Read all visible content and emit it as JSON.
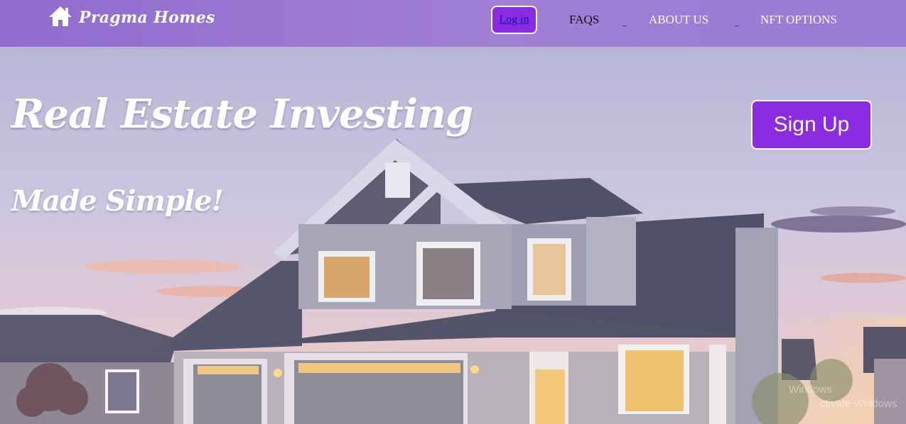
{
  "nav": {
    "brand": "Pragma Homes",
    "login": "Log in",
    "links": [
      "FAQS",
      "ABOUT US",
      "NFT OPTIONS"
    ]
  },
  "hero": {
    "headline": "Real Estate Investing",
    "subline": "Made Simple!",
    "signup": "Sign Up"
  },
  "system": {
    "watermark_line1": "Windows",
    "watermark_line2": "ctivate Windows"
  },
  "colors": {
    "nav_bg": "#9a7ad4",
    "button_purple": "#8b2be2",
    "text_white": "#ffffff"
  },
  "icons": [
    "house-icon"
  ]
}
